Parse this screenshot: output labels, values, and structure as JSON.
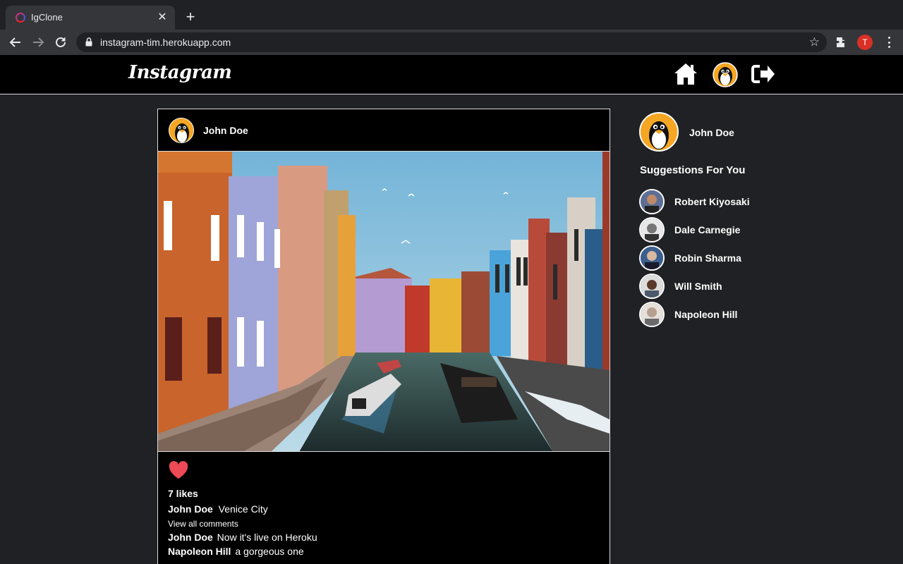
{
  "browser": {
    "tab_title": "IgClone",
    "url": "instagram-tim.herokuapp.com",
    "profile_initial": "T",
    "accent": "#d93025"
  },
  "appnav": {
    "logo": "Instagram",
    "icons": [
      "home-icon",
      "profile-avatar-icon",
      "logout-icon"
    ]
  },
  "post": {
    "author": "John Doe",
    "likes": "7 likes",
    "caption_author": "John Doe",
    "caption_text": "Venice City",
    "view_all": "View all comments",
    "comments": [
      {
        "author": "John Doe",
        "text": "Now it's live on Heroku"
      },
      {
        "author": "Napoleon Hill",
        "text": "a gorgeous one"
      }
    ],
    "like_color": "#ed4956"
  },
  "sidebar": {
    "me": "John Doe",
    "suggestions_title": "Suggestions For You",
    "suggestions": [
      {
        "name": "Robert Kiyosaki"
      },
      {
        "name": "Dale Carnegie"
      },
      {
        "name": "Robin Sharma"
      },
      {
        "name": "Will Smith"
      },
      {
        "name": "Napoleon Hill"
      }
    ]
  }
}
